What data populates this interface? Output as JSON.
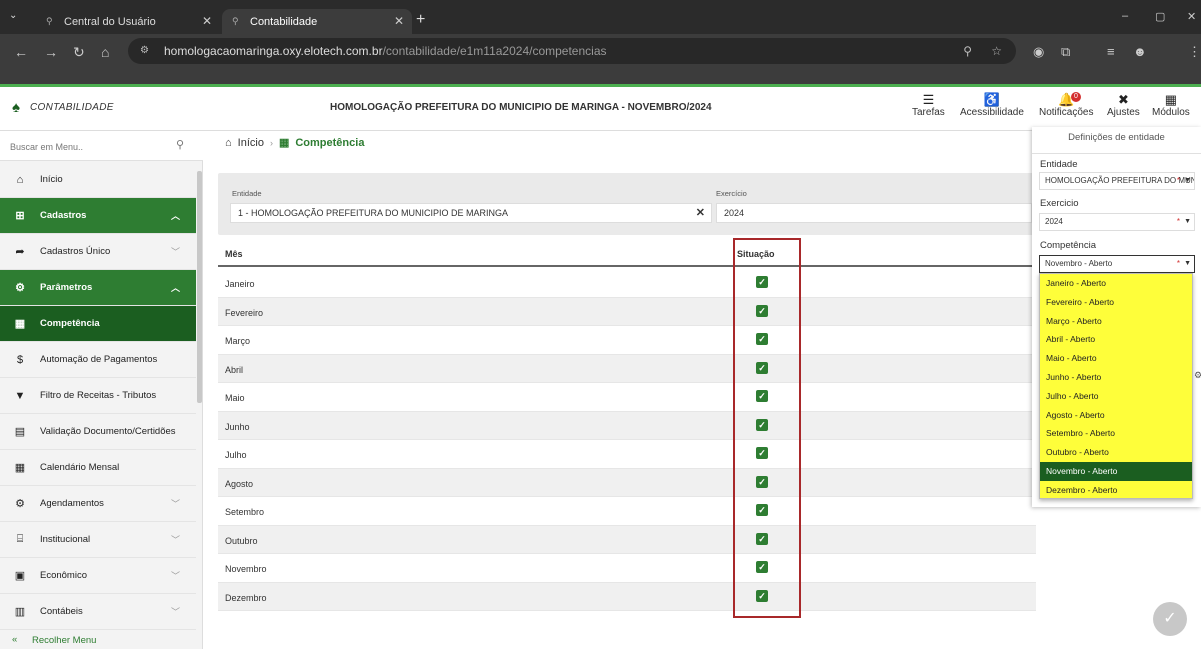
{
  "browser": {
    "tabs": [
      {
        "title": "Central do Usuário"
      },
      {
        "title": "Contabilidade"
      }
    ],
    "url_host": "homologacaomaringa.oxy.elotech.com.br",
    "url_path": "/contabilidade/e1m11a2024/competencias"
  },
  "header": {
    "app_name": "CONTABILIDADE",
    "title": "HOMOLOGAÇÃO PREFEITURA DO MUNICIPIO DE MARINGA - NOVEMBRO/2024",
    "buttons": [
      {
        "label": "Tarefas",
        "icon": "list-icon"
      },
      {
        "label": "Acessibilidade",
        "icon": "accessibility-icon"
      },
      {
        "label": "Notificações",
        "icon": "bell-icon"
      },
      {
        "label": "Ajustes",
        "icon": "tools-icon"
      },
      {
        "label": "Módulos",
        "icon": "grid-icon"
      }
    ],
    "notification_count": "0"
  },
  "sidebar": {
    "search_placeholder": "Buscar em Menu..",
    "items": [
      {
        "label": "Início",
        "icon": "home-icon"
      },
      {
        "label": "Cadastros",
        "icon": "plus-square-icon"
      },
      {
        "label": "Cadastros Único",
        "icon": "share-icon"
      },
      {
        "label": "Parâmetros",
        "icon": "cogs-icon"
      },
      {
        "label": "Competência",
        "icon": "calendar-icon"
      },
      {
        "label": "Automação de Pagamentos",
        "icon": "dollar-icon"
      },
      {
        "label": "Filtro de Receitas - Tributos",
        "icon": "filter-icon"
      },
      {
        "label": "Validação Documento/Certidões",
        "icon": "file-icon"
      },
      {
        "label": "Calendário Mensal",
        "icon": "calendar-icon"
      },
      {
        "label": "Agendamentos",
        "icon": "cogs-icon"
      },
      {
        "label": "Institucional",
        "icon": "institution-icon"
      },
      {
        "label": "Econômico",
        "icon": "money-icon"
      },
      {
        "label": "Contábeis",
        "icon": "calculator-icon"
      }
    ],
    "collapse_label": "Recolher Menu"
  },
  "breadcrumb": {
    "home": "Início",
    "current": "Competência"
  },
  "filter": {
    "entidade_label": "Entidade",
    "entidade_value": "1 - HOMOLOGAÇÃO PREFEITURA DO MUNICIPIO DE MARINGA",
    "exercicio_label": "Exercício",
    "exercicio_value": "2024"
  },
  "table": {
    "headers": [
      "Mês",
      "Situação"
    ],
    "rows": [
      {
        "mes": "Janeiro",
        "situacao": true
      },
      {
        "mes": "Fevereiro",
        "situacao": true
      },
      {
        "mes": "Março",
        "situacao": true
      },
      {
        "mes": "Abril",
        "situacao": true
      },
      {
        "mes": "Maio",
        "situacao": true
      },
      {
        "mes": "Junho",
        "situacao": true
      },
      {
        "mes": "Julho",
        "situacao": true
      },
      {
        "mes": "Agosto",
        "situacao": true
      },
      {
        "mes": "Setembro",
        "situacao": true
      },
      {
        "mes": "Outubro",
        "situacao": true
      },
      {
        "mes": "Novembro",
        "situacao": true
      },
      {
        "mes": "Dezembro",
        "situacao": true
      }
    ]
  },
  "entity_panel": {
    "title": "Definições de entidade",
    "entidade_label": "Entidade",
    "entidade_value": "HOMOLOGAÇÃO PREFEITURA DO MUNICIPIO DE MARINGA",
    "exercicio_label": "Exercicio",
    "exercicio_value": "2024",
    "competencia_label": "Competência",
    "competencia_value": "Novembro - Aberto",
    "required_mark": "*",
    "options": [
      "Janeiro - Aberto",
      "Fevereiro - Aberto",
      "Março - Aberto",
      "Abril - Aberto",
      "Maio - Aberto",
      "Junho - Aberto",
      "Julho - Aberto",
      "Agosto - Aberto",
      "Setembro - Aberto",
      "Outubro - Aberto",
      "Novembro - Aberto",
      "Dezembro - Aberto"
    ],
    "selected_option": "Novembro - Aberto"
  },
  "colors": {
    "brand_green": "#2e7d32",
    "dark_green": "#1b5e20",
    "dropdown_highlight": "#fefe3a",
    "annotation_red": "#a8282a"
  }
}
